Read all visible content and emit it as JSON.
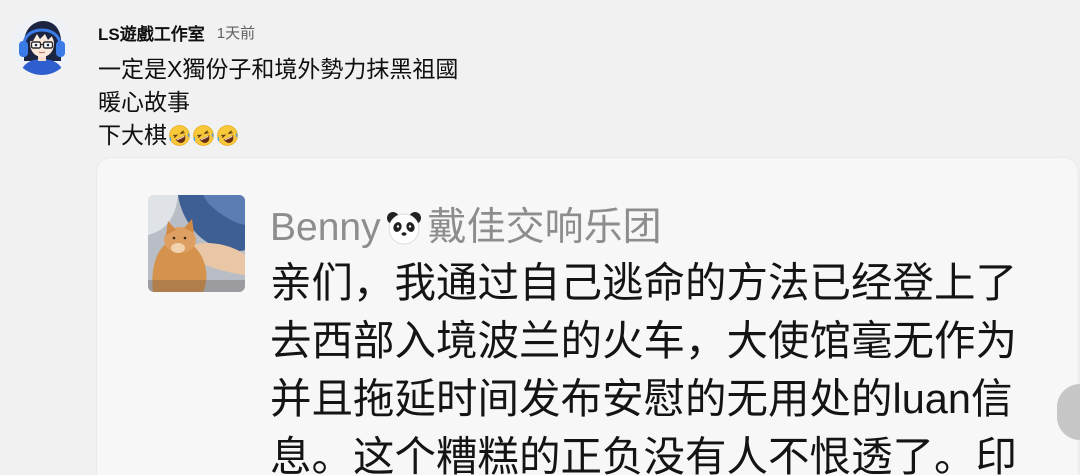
{
  "comment": {
    "author": "LS遊戲工作室",
    "time": "1天前",
    "avatar_icon": "anime-avatar",
    "lines": [
      "一定是X獨份子和境外勢力抹黑祖國",
      "暖心故事",
      "下大棋"
    ],
    "line3_emojis": [
      "rofl-emoji",
      "rofl-emoji",
      "rofl-emoji"
    ]
  },
  "attachment": {
    "sender_avatar_icon": "cat-photo",
    "sender_name": "Benny",
    "sender_name_icon": "panda-emoji",
    "sender_group": "戴佳交响乐团",
    "message_lines": [
      "亲们，我通过自己逃命的方法已经登上了",
      "去西部入境波兰的火车，大使馆毫无作为",
      "并且拖延时间发布安慰的无用处的luan信",
      "息。这个糟糕的正负没有人不恨透了。印"
    ]
  },
  "scroll_button": {
    "icon": "scroll-button"
  },
  "colors": {
    "background": "#f1f1f1",
    "card": "#f7f7f7",
    "author": "#0f0f0f",
    "muted": "#606060",
    "sender": "#8d8d8d",
    "message": "#141414",
    "scroll": "#c6c6c6"
  }
}
